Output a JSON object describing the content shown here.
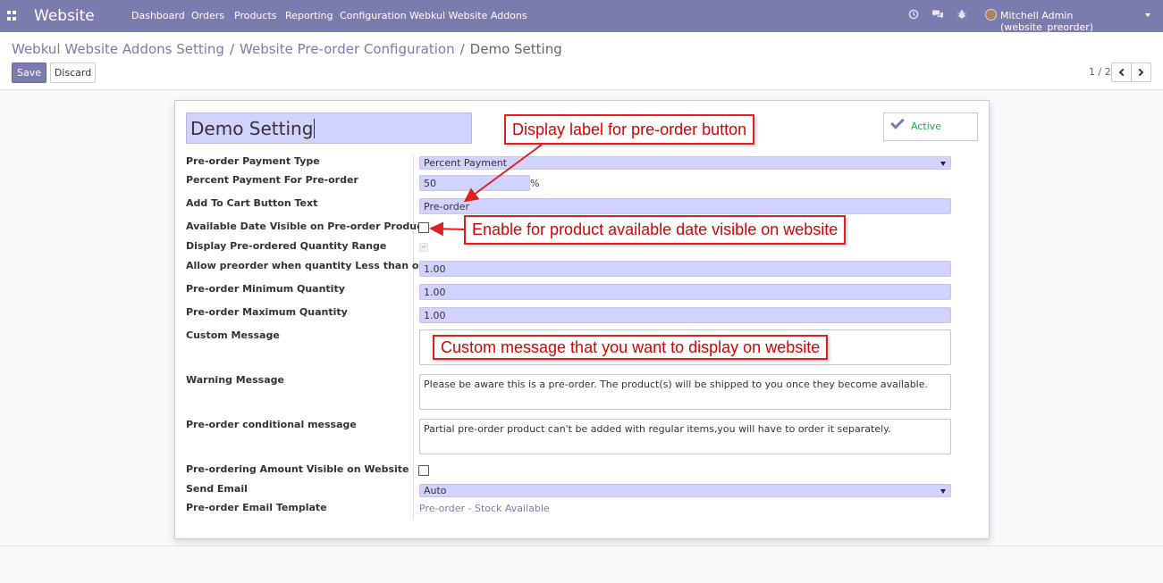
{
  "navbar": {
    "brand": "Website",
    "menu": [
      "Dashboard",
      "Orders",
      "Products",
      "Reporting",
      "Configuration",
      "Webkul Website Addons"
    ],
    "user": "Mitchell Admin (website_preorder)",
    "icons": [
      "clock-icon",
      "chat-icon",
      "bug-icon"
    ]
  },
  "breadcrumb": {
    "items": [
      "Webkul Website Addons Setting",
      "Website Pre-order Configuration"
    ],
    "current": "Demo Setting"
  },
  "actions": {
    "save": "Save",
    "discard": "Discard"
  },
  "pager": {
    "text": "1 / 2"
  },
  "form": {
    "name": "Demo Setting",
    "active_label": "Active",
    "fields": {
      "payment_type": {
        "label": "Pre-order Payment Type",
        "value": "Percent Payment"
      },
      "percent_payment": {
        "label": "Percent Payment For Pre-order",
        "value": "50",
        "unit": "%"
      },
      "cart_button_text": {
        "label": "Add To Cart Button Text",
        "value": "Pre-order"
      },
      "date_visible": {
        "label": "Available Date Visible on Pre-order Product",
        "checked": false
      },
      "qty_range": {
        "label": "Display Pre-ordered Quantity Range",
        "checked": true
      },
      "allow_less": {
        "label": "Allow preorder when quantity Less than or Equal",
        "value": "1.00"
      },
      "min_qty": {
        "label": "Pre-order Minimum Quantity",
        "value": "1.00"
      },
      "max_qty": {
        "label": "Pre-order Maximum Quantity",
        "value": "1.00"
      },
      "custom_message": {
        "label": "Custom Message",
        "value": ""
      },
      "warning_message": {
        "label": "Warning Message",
        "value": "Please be aware this is a pre-order. The product(s) will be shipped to you once they become available."
      },
      "conditional_message": {
        "label": "Pre-order conditional message",
        "value": "Partial pre-order product can't be added with regular items,you will have to order it separately."
      },
      "amount_visible": {
        "label": "Pre-ordering Amount Visible on Website",
        "checked": false
      },
      "send_email": {
        "label": "Send Email",
        "value": "Auto"
      },
      "email_template": {
        "label": "Pre-order Email Template",
        "value": "Pre-order - Stock Available"
      }
    }
  },
  "annotations": {
    "button_label": "Display label for pre-order button",
    "date_visible": "Enable for product available date visible on website",
    "custom_message": "Custom message that you want to display on website"
  },
  "colors": {
    "navbar": "#7c7bad",
    "field": "#d2d2ff",
    "annotation": "#e02020",
    "active": "#28a745"
  }
}
